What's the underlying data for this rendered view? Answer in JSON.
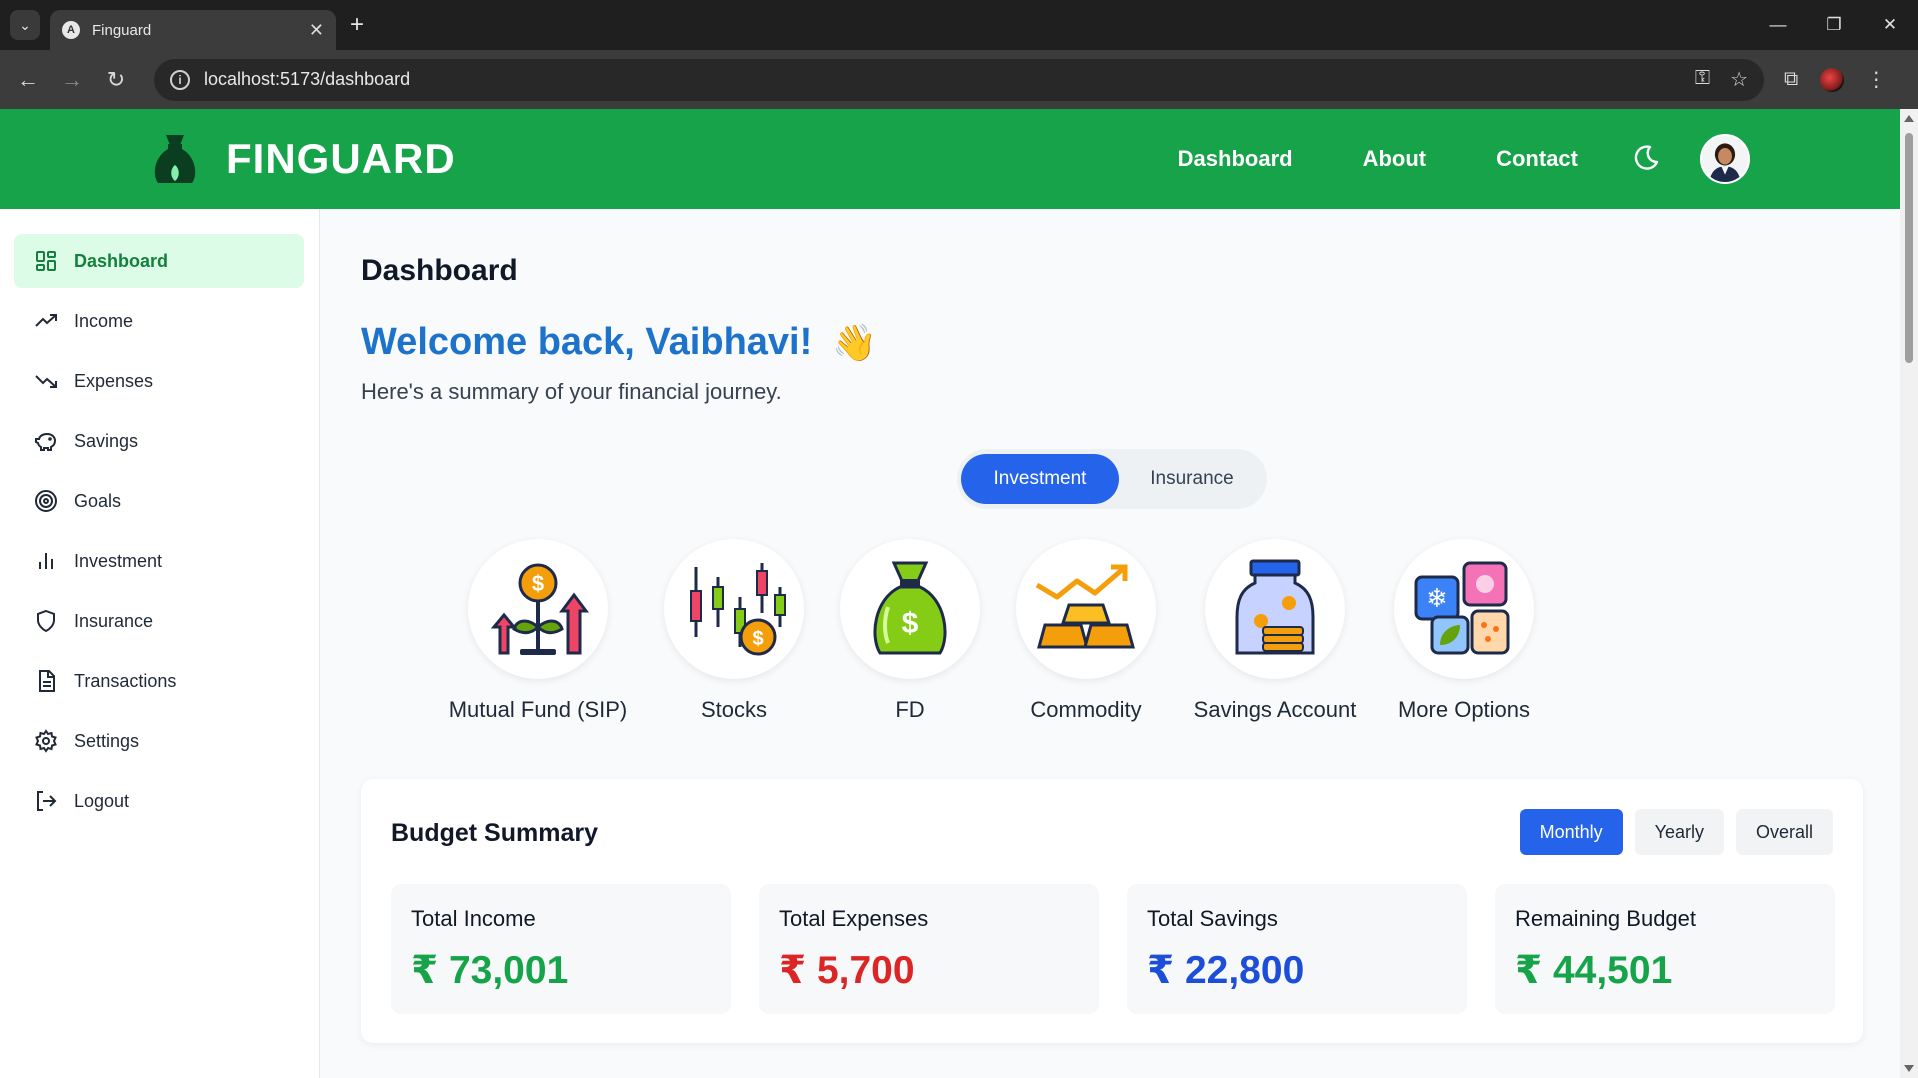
{
  "browser": {
    "tab_title": "Finguard",
    "url": "localhost:5173/dashboard"
  },
  "header": {
    "brand": "FINGUARD",
    "nav": [
      "Dashboard",
      "About",
      "Contact"
    ],
    "brand_color": "#16a34a"
  },
  "sidebar": {
    "items": [
      {
        "label": "Dashboard",
        "icon": "dashboard-grid-icon",
        "active": true
      },
      {
        "label": "Income",
        "icon": "trend-up-icon"
      },
      {
        "label": "Expenses",
        "icon": "trend-down-icon"
      },
      {
        "label": "Savings",
        "icon": "piggy-bank-icon"
      },
      {
        "label": "Goals",
        "icon": "target-icon"
      },
      {
        "label": "Investment",
        "icon": "bar-chart-icon"
      },
      {
        "label": "Insurance",
        "icon": "shield-icon"
      },
      {
        "label": "Transactions",
        "icon": "document-icon"
      },
      {
        "label": "Settings",
        "icon": "gear-icon"
      },
      {
        "label": "Logout",
        "icon": "logout-icon"
      }
    ]
  },
  "main": {
    "title": "Dashboard",
    "welcome": "Welcome back, Vaibhavi!",
    "wave_emoji": "👋",
    "subtitle": "Here's a summary of your financial journey.",
    "toggle": {
      "active": "Investment",
      "inactive": "Insurance"
    },
    "investments": [
      {
        "label": "Mutual Fund (SIP)",
        "icon": "plant-coin-icon"
      },
      {
        "label": "Stocks",
        "icon": "candlestick-icon"
      },
      {
        "label": "FD",
        "icon": "money-bag-icon"
      },
      {
        "label": "Commodity",
        "icon": "gold-bars-icon"
      },
      {
        "label": "Savings Account",
        "icon": "savings-jar-icon"
      },
      {
        "label": "More Options",
        "icon": "more-apps-icon"
      }
    ]
  },
  "budget": {
    "title": "Budget Summary",
    "periods": [
      "Monthly",
      "Yearly",
      "Overall"
    ],
    "active_period": "Monthly",
    "stats": [
      {
        "label": "Total Income",
        "value": "₹ 73,001",
        "color": "green"
      },
      {
        "label": "Total Expenses",
        "value": "₹ 5,700",
        "color": "red"
      },
      {
        "label": "Total Savings",
        "value": "₹ 22,800",
        "color": "blue"
      },
      {
        "label": "Remaining Budget",
        "value": "₹ 44,501",
        "color": "green"
      }
    ]
  }
}
